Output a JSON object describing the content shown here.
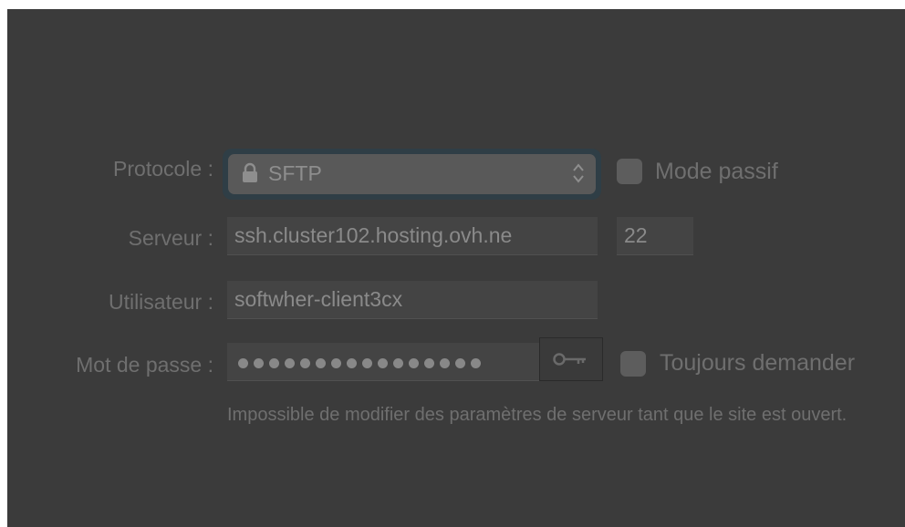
{
  "protocol": {
    "label": "Protocole :",
    "selected": "SFTP",
    "icon": "lock-icon"
  },
  "passive_mode": {
    "label": "Mode passif",
    "checked": false
  },
  "server": {
    "label": "Serveur :",
    "host": "ssh.cluster102.hosting.ovh.ne",
    "port": "22"
  },
  "user": {
    "label": "Utilisateur :",
    "value": "softwher-client3cx"
  },
  "password": {
    "label": "Mot de passe :",
    "masked_length": 16,
    "key_icon": "key-icon"
  },
  "always_ask": {
    "label": "Toujours demander",
    "checked": false
  },
  "note": "Impossible de modifier des paramètres de serveur tant que le site est ouvert.",
  "colors": {
    "panel_bg": "#3b3b3b",
    "field_bg": "#444444",
    "select_focus_ring": "#2f3e46",
    "text_dim": "#6f6f6f"
  }
}
